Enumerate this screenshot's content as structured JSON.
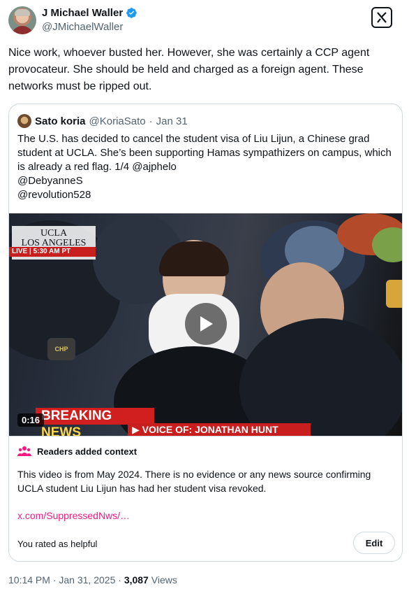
{
  "author": {
    "display_name": "J Michael Waller",
    "handle": "@JMichaelWaller",
    "verified_icon": "verified-badge-icon"
  },
  "tweet": {
    "text": "Nice work, whoever busted her. However, she was certainly a CCP agent provocateur. She should be held and charged as a foreign agent. These networks must be ripped out."
  },
  "quote": {
    "name": "Sato koria",
    "handle": "@KoriaSato",
    "separator": "·",
    "date": "Jan 31",
    "text_line1": "The U.S. has decided to cancel the student visa of Liu Lijun, a Chinese grad student at UCLA. She’s been supporting Hamas sympathizers on campus, which is already a red flag. 1/4 @ajphelo",
    "text_line2": "@DebyanneS",
    "text_line3": "@revolution528",
    "video": {
      "duration": "0:16",
      "overlay_ucla": "UCLA",
      "overlay_city": "LOS ANGELES",
      "overlay_live": "LIVE | 5:30 AM PT",
      "breaking_prefix": "BREAKING ",
      "breaking_word": "NEWS",
      "voice_of": "▶ VOICE OF: JONATHAN HUNT",
      "patch_text": "CHP"
    }
  },
  "community_note": {
    "heading": "Readers added context",
    "body": "This video is from May 2024. There is no evidence or any news source confirming UCLA student Liu Lijun has had her student visa revoked.",
    "link": "x.com/SuppressedNws/…",
    "rated": "You rated as helpful",
    "edit_label": "Edit",
    "accent_color": "#f91880"
  },
  "meta": {
    "time": "10:14 PM",
    "sep1": " · ",
    "date": "Jan 31, 2025",
    "sep2": " · ",
    "views_count": "3,087",
    "views_label": " Views"
  }
}
